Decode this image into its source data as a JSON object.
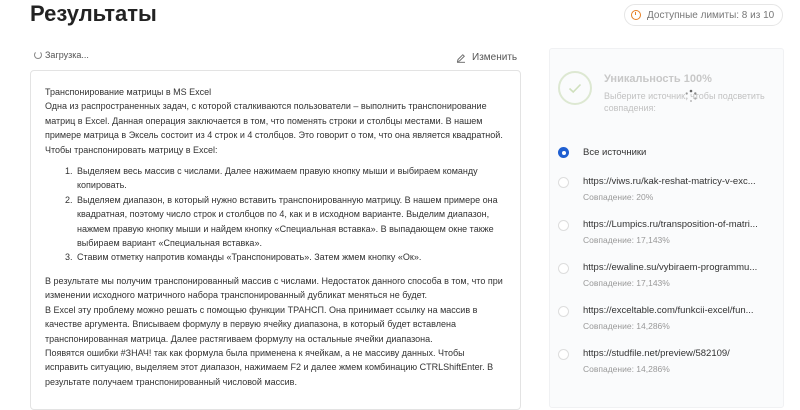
{
  "header": {
    "title": "Результаты",
    "limits_label": "Доступные лимиты: 8 из 10"
  },
  "editor": {
    "loading_label": "Загрузка...",
    "edit_label": "Изменить",
    "title_line": "Транспонирование матрицы в MS Excel",
    "intro": "Одна из распространенных задач, с которой сталкиваются пользователи – выполнить транспонирование матриц в Excel. Данная операция заключается в том, что поменять строки и столбцы местами. В нашем примере матрица в Эксель состоит из 4 строк и 4 столбцов. Это говорит о том, что она является квадратной. Чтобы транспонировать матрицу в Excel:",
    "steps": [
      "Выделяем весь массив с числами. Далее нажимаем правую кнопку мыши и выбираем команду копировать.",
      "Выделяем диапазон, в который нужно вставить транспонированную матрицу. В нашем примере она квадратная, поэтому число строк и столбцов по 4, как и в исходном варианте. Выделим диапазон, нажмем правую кнопку мыши и найдем кнопку «Специальная вставка». В выпадающем окне также выбираем вариант «Специальная вставка».",
      "Ставим отметку напротив команды «Транспонировать». Затем жмем кнопку «Ок»."
    ],
    "outro": [
      "В результате мы получим транспонированный массив с числами. Недостаток данного способа в том, что при изменении исходного матричного набора транспонированный дубликат меняться не будет.",
      "В Excel эту проблему можно решать с помощью функции ТРАНСП. Она принимает ссылку на массив в качестве аргумента. Вписываем формулу в первую ячейку диапазона, в который будет вставлена транспонированная матрица. Далее растягиваем формулу на остальные ячейки диапазона.",
      "Появятся ошибки #ЗНАЧ! так как формула была применена к ячейкам, а не массиву данных. Чтобы исправить ситуацию, выделяем этот диапазон, нажимаем F2 и далее жмем комбинацию CTRLShiftEnter. В результате получаем транспонированный числовой массив."
    ]
  },
  "uniqueness": {
    "title": "Уникальность 100%",
    "hint": "Выберите источник, чтобы подсветить совпадения:"
  },
  "sources": {
    "all_label": "Все источники",
    "items": [
      {
        "url": "https://viws.ru/kak-reshat-matricy-v-exc...",
        "similarity": "Совпадение: 20%"
      },
      {
        "url": "https://Lumpics.ru/transposition-of-matri...",
        "similarity": "Совпадение: 17,143%"
      },
      {
        "url": "https://ewaline.su/vybiraem-programmu...",
        "similarity": "Совпадение: 17,143%"
      },
      {
        "url": "https://exceltable.com/funkcii-excel/fun...",
        "similarity": "Совпадение: 14,286%"
      },
      {
        "url": "https://studfile.net/preview/582109/",
        "similarity": "Совпадение: 14,286%"
      }
    ]
  },
  "colors": {
    "accent": "#1f5fd1",
    "limits_icon": "#e67e22",
    "check": "#cfe0bd"
  }
}
